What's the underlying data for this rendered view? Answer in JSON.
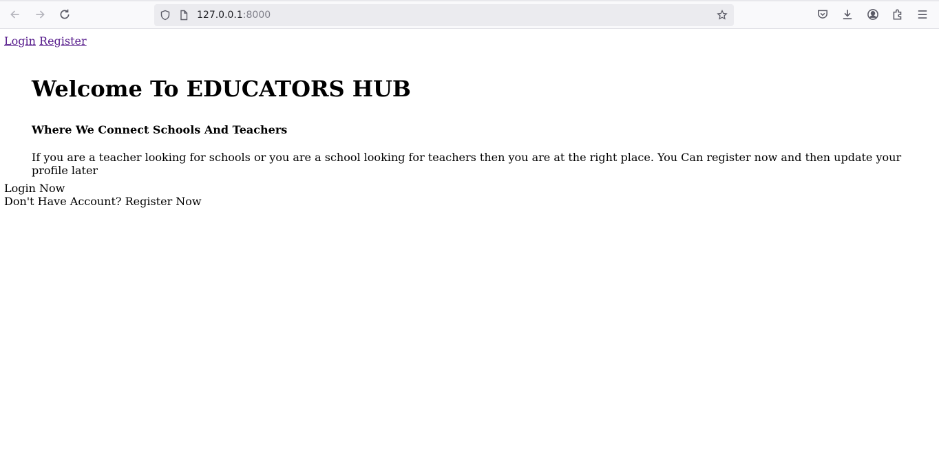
{
  "browser": {
    "url_host": "127.0.0.1",
    "url_port": ":8000",
    "icons": {
      "back": "back-arrow-icon",
      "forward": "forward-arrow-icon",
      "reload": "reload-icon",
      "site_info": "shield-icon",
      "page": "page-icon",
      "bookmark": "star-icon",
      "pocket": "pocket-icon",
      "downloads": "download-icon",
      "account": "account-icon",
      "extensions": "extensions-icon",
      "menu": "hamburger-menu-icon"
    }
  },
  "nav": {
    "login": "Login",
    "register": "Register"
  },
  "hero": {
    "title": "Welcome To EDUCATORS HUB",
    "subtitle": "Where We Connect Schools And Teachers",
    "description": "If you are a teacher looking for schools or you are a school looking for teachers then you are at the right place. You Can register now and then update your profile later"
  },
  "actions": {
    "login_now": "Login Now",
    "register_now": "Don't Have Account? Register Now"
  },
  "colors": {
    "visited_link": "#551a8b",
    "toolbar_bg": "#f9f9fb",
    "urlbar_bg": "#ebebef"
  }
}
